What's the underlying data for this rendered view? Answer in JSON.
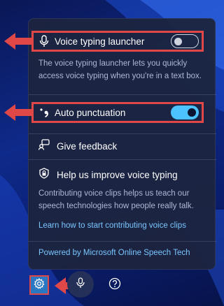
{
  "panel": {
    "launcher": {
      "label": "Voice typing launcher",
      "toggle_on": false,
      "icon": "microphone-icon"
    },
    "launcher_description": "The voice typing launcher lets you quickly access voice typing when you're in a text box.",
    "punctuation": {
      "label": "Auto punctuation",
      "toggle_on": true,
      "icon": "punctuation-icon"
    },
    "feedback": {
      "label": "Give feedback",
      "icon": "feedback-icon"
    },
    "improve": {
      "title": "Help us improve voice typing",
      "icon": "shield-lock-icon",
      "body": "Contributing voice clips helps us teach our speech technologies how people really talk.",
      "link": "Learn how to start contributing voice clips"
    },
    "powered_by": "Powered by Microsoft Online Speech Tech"
  },
  "toolbar": {
    "buttons": [
      "settings-gear-icon",
      "microphone-icon",
      "help-icon"
    ]
  },
  "colors": {
    "accent": "#4cc2ff",
    "highlight": "#e04848",
    "link": "#7ac6ff",
    "panel_bg": "#1c2440"
  }
}
